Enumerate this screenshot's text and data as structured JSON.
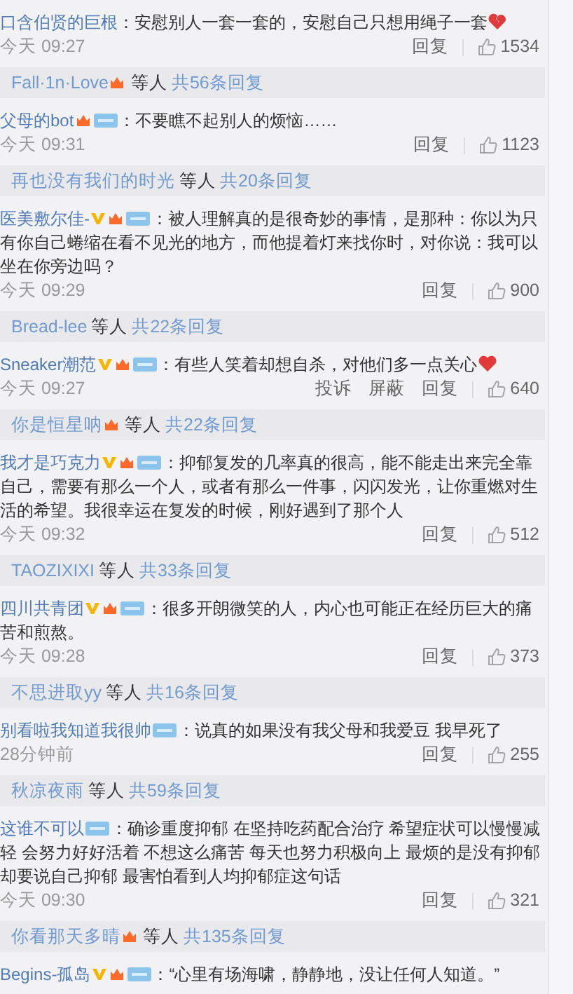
{
  "items": [
    {
      "kind": "comment",
      "author": "口含伯贤的巨根",
      "text": "：安慰别人一套一套的，安慰自己只想用绳子一套",
      "end_icon": {
        "kind": "broken-heart"
      },
      "time": "今天 09:27",
      "actions": [
        "回复"
      ],
      "likes": "1534"
    },
    {
      "kind": "replies",
      "name": "Fall·1n·Love",
      "badge": true,
      "suffix": "等人",
      "count": "共56条回复"
    },
    {
      "kind": "comment",
      "author": "父母的bot",
      "badges": [
        {
          "kind": "orange"
        },
        {
          "kind": "tag"
        }
      ],
      "text": "：不要瞧不起别人的烦恼……",
      "time": "今天 09:31",
      "actions": [
        "回复"
      ],
      "likes": "1123"
    },
    {
      "kind": "replies",
      "name": "再也没有我们的时光",
      "badge": false,
      "suffix": "等人",
      "count": "共20条回复"
    },
    {
      "kind": "comment",
      "author": "医美敷尔佳-",
      "badges": [
        {
          "kind": "v"
        },
        {
          "kind": "orange"
        },
        {
          "kind": "tag"
        }
      ],
      "text": "：被人理解真的是很奇妙的事情，是那种：你以为只有你自己蜷缩在看不见光的地方，而他提着灯来找你时，对你说：我可以坐在你旁边吗？",
      "time": "今天 09:29",
      "actions": [
        "回复"
      ],
      "likes": "900"
    },
    {
      "kind": "replies",
      "name": "Bread-lee",
      "badge": false,
      "suffix": "等人",
      "count": "共22条回复"
    },
    {
      "kind": "comment",
      "author": "Sneaker潮范",
      "badges": [
        {
          "kind": "v"
        },
        {
          "kind": "orange"
        },
        {
          "kind": "tag"
        }
      ],
      "text": "：有些人笑着却想自杀，对他们多一点关心",
      "end_icon": {
        "kind": "heart"
      },
      "time": "今天 09:27",
      "actions": [
        "投诉",
        "屏蔽",
        "回复"
      ],
      "likes": "640"
    },
    {
      "kind": "replies",
      "name": "你是恒星呐",
      "badge": true,
      "suffix": "等人",
      "count": "共22条回复"
    },
    {
      "kind": "comment",
      "author": "我才是巧克力",
      "badges": [
        {
          "kind": "v"
        },
        {
          "kind": "orange"
        },
        {
          "kind": "tag"
        }
      ],
      "text": "：抑郁复发的几率真的很高，能不能走出来完全靠自己，需要有那么一个人，或者有那么一件事，闪闪发光，让你重燃对生活的希望。我很幸运在复发的时候，刚好遇到了那个人",
      "time": "今天 09:32",
      "actions": [
        "回复"
      ],
      "likes": "512"
    },
    {
      "kind": "replies",
      "name": "TAOZIXIXI",
      "badge": false,
      "suffix": "等人",
      "count": "共33条回复"
    },
    {
      "kind": "comment",
      "author": "四川共青团",
      "badges": [
        {
          "kind": "v"
        },
        {
          "kind": "orange"
        },
        {
          "kind": "tag"
        }
      ],
      "text": "：很多开朗微笑的人，内心也可能正在经历巨大的痛苦和煎熬。",
      "time": "今天 09:28",
      "actions": [
        "回复"
      ],
      "likes": "373"
    },
    {
      "kind": "replies",
      "name": "不思进取yy",
      "badge": false,
      "suffix": "等人",
      "count": "共16条回复"
    },
    {
      "kind": "comment",
      "author": "别看啦我知道我很帅",
      "badges": [
        {
          "kind": "tag"
        }
      ],
      "text": "：说真的如果没有我父母和我爱豆  我早死了",
      "time": "28分钟前",
      "actions": [
        "回复"
      ],
      "likes": "255"
    },
    {
      "kind": "replies",
      "name": "秋凉夜雨",
      "badge": false,
      "suffix": "等人",
      "count": "共59条回复"
    },
    {
      "kind": "comment",
      "author": "这谁不可以",
      "badges": [
        {
          "kind": "tag"
        }
      ],
      "text": "：确诊重度抑郁 在坚持吃药配合治疗 希望症状可以慢慢减轻 会努力好好活着 不想这么痛苦 每天也努力积极向上 最烦的是没有抑郁却要说自己抑郁 最害怕看到人均抑郁症这句话",
      "time": "今天 09:30",
      "actions": [
        "回复"
      ],
      "likes": "321"
    },
    {
      "kind": "replies",
      "name": "你看那天多晴",
      "badge": true,
      "suffix": "等人",
      "count": "共135条回复"
    },
    {
      "kind": "comment",
      "author": "Begins-孤岛",
      "badges": [
        {
          "kind": "v"
        },
        {
          "kind": "orange"
        },
        {
          "kind": "tag"
        }
      ],
      "text": "：“心里有场海啸，静静地，没让任何人知道。”"
    }
  ]
}
